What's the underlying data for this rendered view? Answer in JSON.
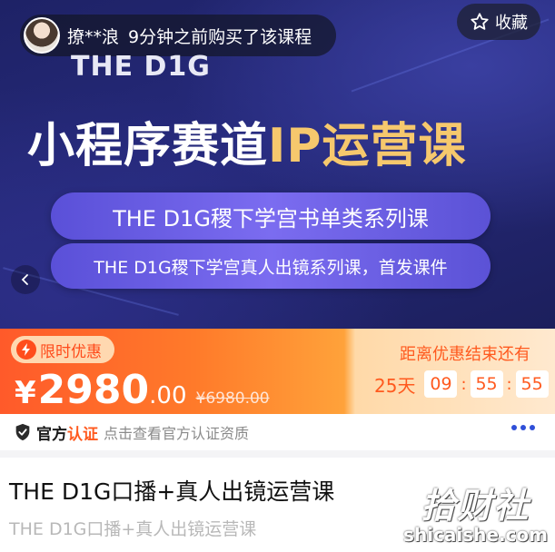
{
  "banner": {
    "buyer_name": "撩**浪",
    "buyer_action": "9分钟之前购买了该课程",
    "favorite_label": "收藏",
    "brand": "THE D1G",
    "title_main": "小程序赛道",
    "title_accent": "IP运营课",
    "chip1": "THE D1G稷下学宫书单类系列课",
    "chip2": "THE D1G稷下学宫真人出镜系列课，首发课件"
  },
  "price": {
    "badge": "限时优惠",
    "currency": "¥",
    "integer": "2980",
    "decimal": ".00",
    "original": "¥6980.00",
    "countdown_label": "距离优惠结束还有",
    "days": "25天",
    "hours": "09",
    "minutes": "55",
    "seconds": "55"
  },
  "official": {
    "label_a": "官方",
    "label_b": "认证",
    "hint": "点击查看官方认证资质"
  },
  "course": {
    "title": "THE D1G口播+真人出镜运营课",
    "subtitle": "THE D1G口播+真人出镜运营课"
  },
  "watermark": {
    "cn": "拾财社",
    "en": "shicaishe.com"
  },
  "colors": {
    "accent": "#ff5a1f",
    "banner_bg": "#262a7c",
    "gold": "#f6c86d"
  }
}
